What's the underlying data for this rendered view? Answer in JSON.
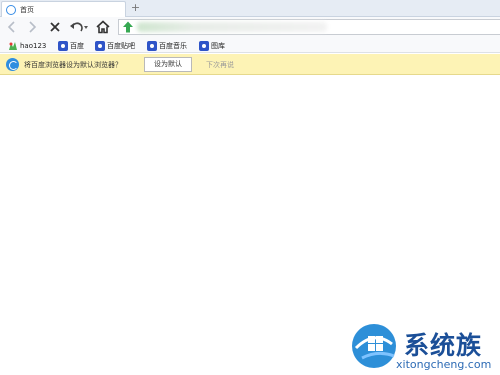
{
  "tabs": [
    {
      "title": "首页"
    }
  ],
  "new_tab_label": "+",
  "toolbar": {
    "icons": [
      "back-icon",
      "forward-icon",
      "stop-icon",
      "undo-icon",
      "home-icon"
    ]
  },
  "address_bar": {
    "security_icon": "green-shield-icon"
  },
  "bookmarks": [
    {
      "label": "hao123",
      "icon": "hao123-icon"
    },
    {
      "label": "百度",
      "icon": "baidu-paw-icon"
    },
    {
      "label": "百度贴吧",
      "icon": "baidu-paw-icon"
    },
    {
      "label": "百度音乐",
      "icon": "baidu-paw-icon"
    },
    {
      "label": "图库",
      "icon": "baidu-paw-icon"
    }
  ],
  "notification": {
    "message": "将百度浏览器设为默认浏览器？",
    "primary_button": "设为默认",
    "secondary_link": "下次再说"
  },
  "watermark": {
    "title": "系统族",
    "url": "xitongcheng.com"
  },
  "colors": {
    "accent": "#2f8ee0",
    "notification_bg": "#fdf3b5",
    "baidu_blue": "#2f54c8"
  }
}
